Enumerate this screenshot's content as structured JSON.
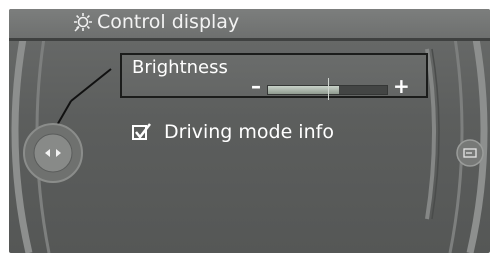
{
  "header": {
    "title": "Control display",
    "icon": "settings-gear-icon"
  },
  "brightness": {
    "label": "Brightness",
    "minus_symbol": "–",
    "plus_symbol": "+",
    "level": 0.6
  },
  "driving_mode": {
    "label": "Driving mode info",
    "checked": true
  },
  "controller": {
    "icon": "left-right-controller-icon"
  },
  "right_button": {
    "icon": "options-icon"
  },
  "colors": {
    "background": "#5c5e5d",
    "header": "#737574",
    "text": "#ffffff",
    "slider_fill": "#b8c2b8"
  }
}
